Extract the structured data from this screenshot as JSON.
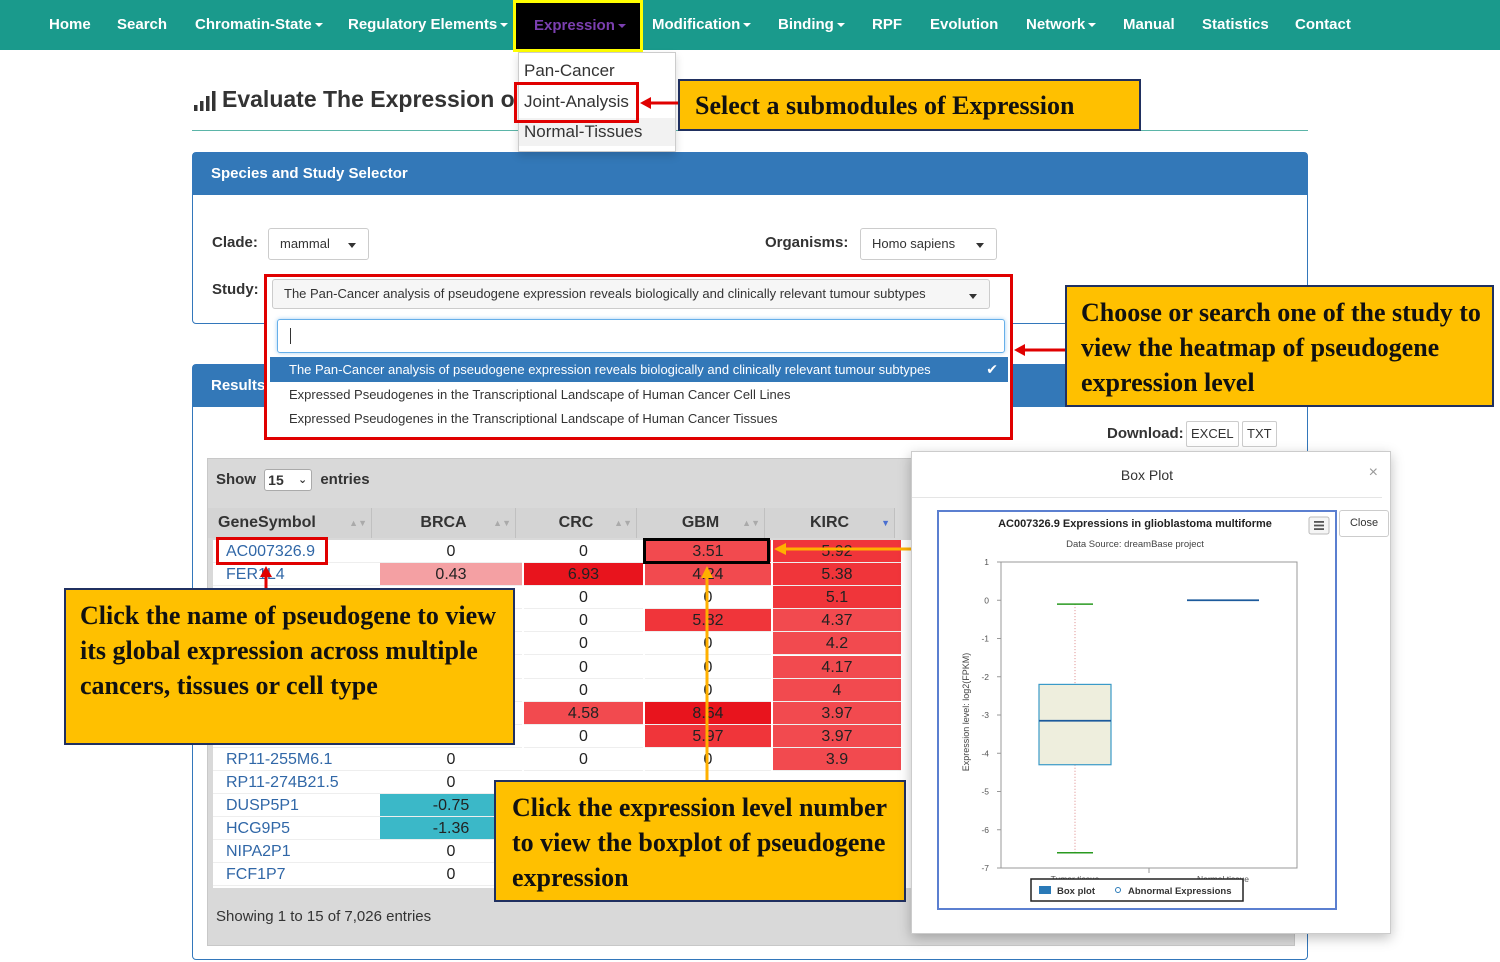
{
  "nav": {
    "items": [
      "Home",
      "Search",
      "Chromatin-State",
      "Regulatory Elements",
      "Expression",
      "Modification",
      "Binding",
      "RPF",
      "Evolution",
      "Network",
      "Manual",
      "Statistics",
      "Contact"
    ]
  },
  "expression_menu": [
    "Pan-Cancer",
    "Joint-Analysis",
    "Normal-Tissues"
  ],
  "page": {
    "title": "Evaluate The Expression o"
  },
  "selector_panel": {
    "heading": "Species and Study Selector",
    "clade_label": "Clade:",
    "clade_value": "mammal",
    "organisms_label": "Organisms:",
    "organisms_value": "Homo sapiens",
    "study_label": "Study:",
    "study_value": "The Pan-Cancer analysis of pseudogene expression reveals biologically and clinically relevant tumour subtypes",
    "study_search_value": "",
    "study_options": [
      "The Pan-Cancer analysis of pseudogene expression reveals biologically and clinically relevant tumour subtypes",
      "Expressed Pseudogenes in the Transcriptional Landscape of Human Cancer Cell Lines",
      "Expressed Pseudogenes in the Transcriptional Landscape of Human Cancer Tissues"
    ]
  },
  "results_panel": {
    "heading": "Results",
    "download_label": "Download:",
    "download_excel": "EXCEL",
    "download_txt": "TXT",
    "show_label": "Show",
    "entries_value": "15",
    "entries_label": "entries",
    "showing_info": "Showing 1 to 15 of 7,026 entries",
    "columns": [
      "GeneSymbol",
      "BRCA",
      "CRC",
      "GBM",
      "KIRC"
    ],
    "rows": [
      {
        "gene": "AC007326.9",
        "BRCA": "0",
        "CRC": "0",
        "GBM": "3.51",
        "KIRC": "5.92"
      },
      {
        "gene": "FER1L4",
        "BRCA": "0.43",
        "CRC": "6.93",
        "GBM": "4.24",
        "KIRC": "5.38"
      },
      {
        "gene": "",
        "BRCA": "",
        "CRC": "0",
        "GBM": "0",
        "KIRC": "5.1"
      },
      {
        "gene": "",
        "BRCA": "",
        "CRC": "0",
        "GBM": "5.82",
        "KIRC": "4.37"
      },
      {
        "gene": "",
        "BRCA": "",
        "CRC": "0",
        "GBM": "0",
        "KIRC": "4.2"
      },
      {
        "gene": "",
        "BRCA": "",
        "CRC": "0",
        "GBM": "0",
        "KIRC": "4.17"
      },
      {
        "gene": "",
        "BRCA": "",
        "CRC": "0",
        "GBM": "0",
        "KIRC": "4"
      },
      {
        "gene": "",
        "BRCA": "",
        "CRC": "4.58",
        "GBM": "8.64",
        "KIRC": "3.97"
      },
      {
        "gene": "",
        "BRCA": "",
        "CRC": "0",
        "GBM": "5.97",
        "KIRC": "3.97"
      },
      {
        "gene": "RP11-255M6.1",
        "BRCA": "0",
        "CRC": "0",
        "GBM": "0",
        "KIRC": "3.9"
      },
      {
        "gene": "RP11-274B21.5",
        "BRCA": "0",
        "CRC": "",
        "GBM": "",
        "KIRC": ""
      },
      {
        "gene": "DUSP5P1",
        "BRCA": "-0.75",
        "CRC": "",
        "GBM": "",
        "KIRC": ""
      },
      {
        "gene": "HCG9P5",
        "BRCA": "-1.36",
        "CRC": "",
        "GBM": "",
        "KIRC": ""
      },
      {
        "gene": "NIPA2P1",
        "BRCA": "0",
        "CRC": "",
        "GBM": "",
        "KIRC": ""
      },
      {
        "gene": "FCF1P7",
        "BRCA": "0",
        "CRC": "",
        "GBM": "",
        "KIRC": ""
      }
    ]
  },
  "callouts": {
    "submodule": "Select a submodules of Expression",
    "study": "Choose or search one of the study to view the heatmap of pseudogene expression level",
    "gene": "Click the name of pseudogene to view its global expression across multiple cancers, tissues or cell type",
    "expression": "Click the expression level number to view the boxplot of pseudogene expression"
  },
  "modal": {
    "title": "Box Plot",
    "close_label": "Close",
    "close_icon": "close-icon"
  },
  "colors": {
    "nav": "#1a9a8c",
    "panel_head": "#3378b8",
    "callout": "#ffc000",
    "highlight_red": "#e00000",
    "heat_high": "#f0353a",
    "heat_low": "#3bb8c8"
  },
  "chart_data": {
    "type": "box",
    "title": "AC007326.9 Expressions in glioblastoma multiforme",
    "subtitle": "Data Source: dreamBase project",
    "ylabel": "Expression level: log2(FPKM)",
    "xlabel": "",
    "ylim": [
      -7,
      1
    ],
    "yticks": [
      1,
      0,
      -1,
      -2,
      -3,
      -4,
      -5,
      -6,
      -7
    ],
    "categories": [
      "Tumor tissue",
      "Normal tissue"
    ],
    "boxes": [
      {
        "name": "Tumor tissue",
        "min": -6.6,
        "q1": -4.3,
        "median": -3.15,
        "q3": -2.2,
        "max": -0.1
      },
      {
        "name": "Normal tissue",
        "min": 0.0,
        "q1": 0.0,
        "median": 0.0,
        "q3": 0.0,
        "max": 0.0
      }
    ],
    "legend": [
      "Box plot",
      "Abnormal Expressions"
    ],
    "legend_position": "bottom",
    "grid": false
  }
}
